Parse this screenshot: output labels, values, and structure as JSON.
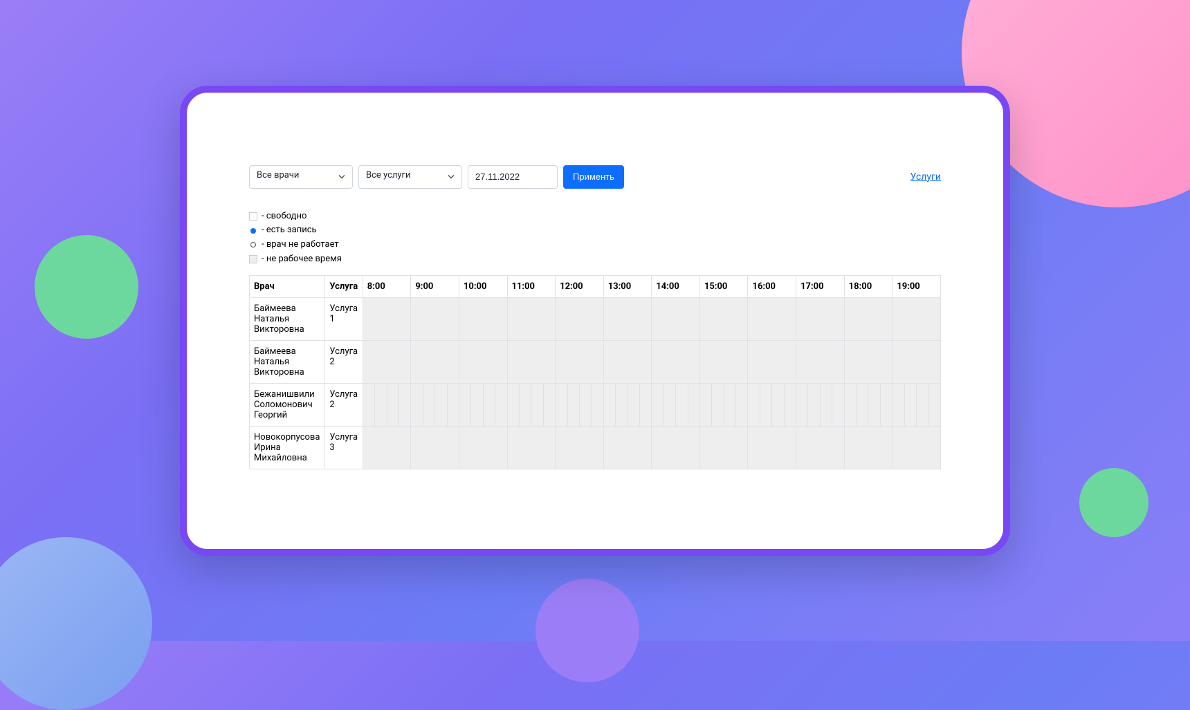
{
  "filters": {
    "doctor_select": "Все врачи",
    "service_select": "Все услуги",
    "date_value": "27.11.2022",
    "apply_label": "Применть"
  },
  "services_link_label": "Услуги",
  "legend": {
    "free": "- свободно",
    "booked": "- есть запись",
    "not_working": "- врач не работает",
    "non_working_time": "- не рабочее время"
  },
  "table": {
    "header_doctor": "Врач",
    "header_service": "Услуга",
    "time_columns": [
      "8:00",
      "9:00",
      "10:00",
      "11:00",
      "12:00",
      "13:00",
      "14:00",
      "15:00",
      "16:00",
      "17:00",
      "18:00",
      "19:00"
    ],
    "rows": [
      {
        "doctor": "Баймеева Наталья Викторовна",
        "service": "Услуга 1",
        "segments": 0
      },
      {
        "doctor": "Баймеева Наталья Викторовна",
        "service": "Услуга 2",
        "segments": 0
      },
      {
        "doctor": "Бежанишвили Соломонович Георгий",
        "service": "Услуга 2",
        "segments": 4
      },
      {
        "doctor": "Новокорпусова Ирина Михайловна",
        "service": "Услуга 3",
        "segments": 0
      }
    ]
  }
}
